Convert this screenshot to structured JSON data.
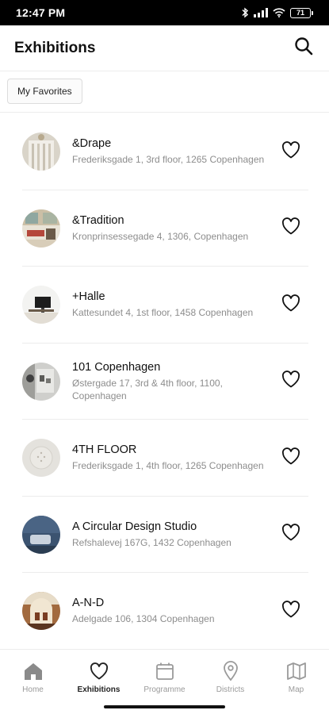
{
  "status_bar": {
    "time": "12:47 PM",
    "battery": "71",
    "icons": [
      "bluetooth-icon",
      "signal-icon",
      "wifi-icon",
      "battery-icon"
    ]
  },
  "header": {
    "title": "Exhibitions",
    "search_icon": "search-icon"
  },
  "filters": {
    "favorites_label": "My Favorites"
  },
  "exhibitions": [
    {
      "name": "&Drape",
      "address": "Frederiksgade 1, 3rd floor, 1265 Copenhagen",
      "favorite_icon": "heart-outline-icon"
    },
    {
      "name": "&Tradition",
      "address": "Kronprinsessegade 4, 1306, Copenhagen",
      "favorite_icon": "heart-outline-icon"
    },
    {
      "name": "+Halle",
      "address": "Kattesundet 4, 1st floor, 1458 Copenhagen",
      "favorite_icon": "heart-outline-icon"
    },
    {
      "name": "101 Copenhagen",
      "address": "Østergade 17, 3rd & 4th floor, 1100, Copenhagen",
      "favorite_icon": "heart-outline-icon"
    },
    {
      "name": "4TH FLOOR",
      "address": "Frederiksgade 1, 4th floor, 1265 Copenhagen",
      "favorite_icon": "heart-outline-icon"
    },
    {
      "name": "A Circular Design Studio",
      "address": "Refshalevej 167G, 1432 Copenhagen",
      "favorite_icon": "heart-outline-icon"
    },
    {
      "name": "A-N-D",
      "address": "Adelgade 106, 1304 Copenhagen",
      "favorite_icon": "heart-outline-icon"
    }
  ],
  "bottom_nav": [
    {
      "label": "Home",
      "icon": "home-icon",
      "active": false
    },
    {
      "label": "Exhibitions",
      "icon": "heart-icon",
      "active": true
    },
    {
      "label": "Programme",
      "icon": "calendar-icon",
      "active": false
    },
    {
      "label": "Districts",
      "icon": "location-pin-icon",
      "active": false
    },
    {
      "label": "Map",
      "icon": "map-icon",
      "active": false
    }
  ],
  "colors": {
    "text_primary": "#111111",
    "text_secondary": "#8d8d8d",
    "nav_inactive": "#9a9a9a",
    "divider": "#ececec"
  }
}
